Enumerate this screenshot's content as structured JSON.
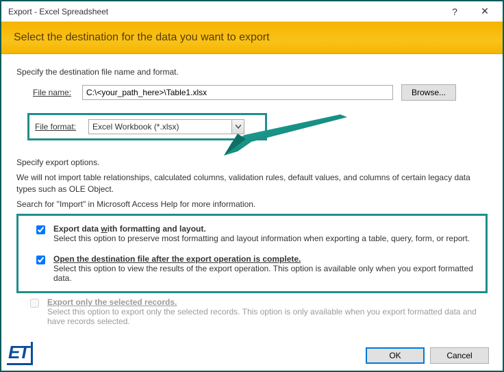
{
  "window": {
    "title": "Export - Excel Spreadsheet",
    "help_icon": "?",
    "close_icon": "✕"
  },
  "banner": {
    "text": "Select the destination for the data you want to export"
  },
  "section1": {
    "intro": "Specify the destination file name and format.",
    "filename_label": "File name:",
    "filename_value": "C:\\<your_path_here>\\Table1.xlsx",
    "browse_label": "Browse...",
    "format_label": "File format:",
    "format_value": "Excel Workbook (*.xlsx)"
  },
  "section2": {
    "intro": "Specify export options.",
    "note": "We will not import table relationships, calculated columns, validation rules, default values, and columns of certain legacy data types such as OLE Object.",
    "help": "Search for \"Import\" in Microsoft Access Help for more information.",
    "opt1_label": "Export data with formatting and layout.",
    "opt1_desc": "Select this option to preserve most formatting and layout information when exporting a table, query, form, or report.",
    "opt2_label": "Open the destination file after the export operation is complete.",
    "opt2_desc": "Select this option to view the results of the export operation. This option is available only when you export formatted data.",
    "opt3_label": "Export only the selected records.",
    "opt3_desc": "Select this option to export only the selected records. This option is only available when you export formatted data and have records selected."
  },
  "footer": {
    "ok": "OK",
    "cancel": "Cancel"
  },
  "logo": "ET"
}
